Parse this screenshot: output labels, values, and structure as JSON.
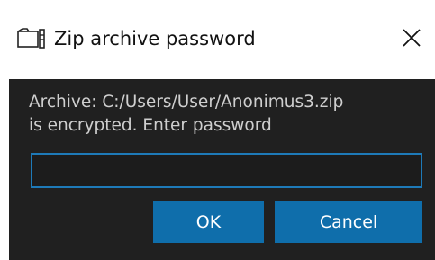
{
  "dialog": {
    "title": "Zip archive password",
    "title_icon": "archive-icon",
    "close_icon": "close-icon",
    "message_line1": "Archive: C:/Users/User/Anonimus3.zip",
    "message_line2": "is encrypted. Enter password",
    "password_value": "",
    "password_placeholder": "",
    "ok_label": "OK",
    "cancel_label": "Cancel"
  },
  "colors": {
    "panel_background": "#202020",
    "accent": "#0f6eab",
    "input_border": "#1e7ab8",
    "message_text": "#cfcfcf"
  }
}
